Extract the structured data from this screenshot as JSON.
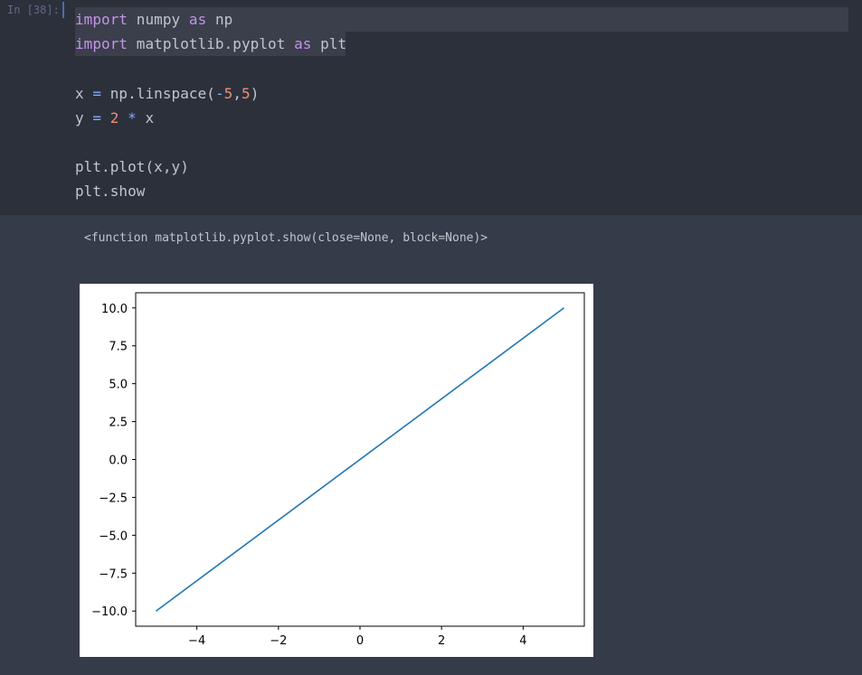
{
  "cell": {
    "prompt": "In [38]:",
    "code_lines": [
      [
        {
          "t": "import",
          "c": "kw"
        },
        {
          "t": " numpy ",
          "c": "pl"
        },
        {
          "t": "as",
          "c": "kw"
        },
        {
          "t": " np",
          "c": "pl"
        }
      ],
      [
        {
          "t": "import",
          "c": "kw"
        },
        {
          "t": " matplotlib.pyplot ",
          "c": "pl"
        },
        {
          "t": "as",
          "c": "kw"
        },
        {
          "t": " plt",
          "c": "pl"
        }
      ],
      [],
      [
        {
          "t": "x ",
          "c": "pl"
        },
        {
          "t": "=",
          "c": "op"
        },
        {
          "t": " np.linspace(",
          "c": "pl"
        },
        {
          "t": "-",
          "c": "op"
        },
        {
          "t": "5",
          "c": "num"
        },
        {
          "t": ",",
          "c": "pl"
        },
        {
          "t": "5",
          "c": "num"
        },
        {
          "t": ")",
          "c": "pl"
        }
      ],
      [
        {
          "t": "y ",
          "c": "pl"
        },
        {
          "t": "=",
          "c": "op"
        },
        {
          "t": " ",
          "c": "pl"
        },
        {
          "t": "2",
          "c": "num"
        },
        {
          "t": " ",
          "c": "pl"
        },
        {
          "t": "*",
          "c": "op"
        },
        {
          "t": " x",
          "c": "pl"
        }
      ],
      [],
      [
        {
          "t": "plt.plot(x,y)",
          "c": "pl"
        }
      ],
      [
        {
          "t": "plt.show",
          "c": "pl"
        }
      ]
    ]
  },
  "output": {
    "text": "<function matplotlib.pyplot.show(close=None, block=None)>"
  },
  "colors": {
    "line": "#1f77b4",
    "input_bg": "#2b303b",
    "output_bg": "#353c49"
  },
  "chart_data": {
    "type": "line",
    "title": "",
    "xlabel": "",
    "ylabel": "",
    "series": [
      {
        "x": [
          -5,
          5
        ],
        "y": [
          -10,
          10
        ]
      }
    ],
    "xlim": [
      -5.5,
      5.5
    ],
    "ylim": [
      -11,
      11
    ],
    "x_ticks": [
      -4,
      -2,
      0,
      2,
      4
    ],
    "x_tick_labels": [
      "−4",
      "−2",
      "0",
      "2",
      "4"
    ],
    "y_ticks": [
      10,
      7.5,
      5,
      2.5,
      0,
      -2.5,
      -5,
      -7.5,
      -10
    ],
    "y_tick_labels": [
      "10.0",
      "7.5",
      "5.0",
      "2.5",
      "0.0",
      "−2.5",
      "−5.0",
      "−7.5",
      "−10.0"
    ],
    "grid": false
  }
}
